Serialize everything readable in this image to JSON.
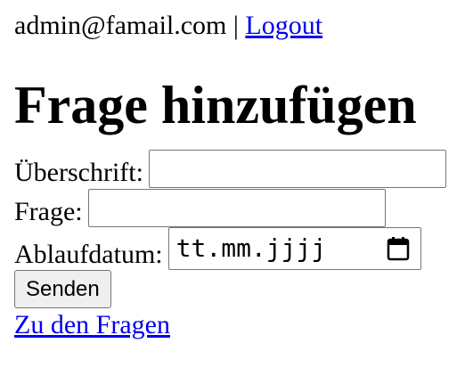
{
  "header": {
    "user_email": "admin@famail.com",
    "separator": "|",
    "logout_label": "Logout"
  },
  "page_title": "Frage hinzufügen",
  "form": {
    "heading_label": "Überschrift:",
    "heading_value": "",
    "question_label": "Frage:",
    "question_value": "",
    "expiry_label": "Ablaufdatum:",
    "expiry_placeholder": "tt.mm.jjjj",
    "submit_label": "Senden"
  },
  "back_link": "Zu den Fragen",
  "icons": {
    "date_picker": "calendar-icon"
  }
}
